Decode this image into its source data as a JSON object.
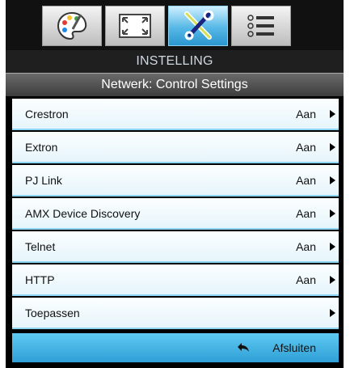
{
  "tabs": [
    {
      "icon": "palette-icon",
      "active": false
    },
    {
      "icon": "fullscreen-icon",
      "active": false
    },
    {
      "icon": "tools-icon",
      "active": true
    },
    {
      "icon": "list-icon",
      "active": false
    }
  ],
  "header": {
    "title": "INSTELLING",
    "subtitle": "Netwerk: Control Settings"
  },
  "items": [
    {
      "label": "Crestron",
      "value": "Aan"
    },
    {
      "label": "Extron",
      "value": "Aan"
    },
    {
      "label": "PJ Link",
      "value": "Aan"
    },
    {
      "label": "AMX Device Discovery",
      "value": "Aan"
    },
    {
      "label": "Telnet",
      "value": "Aan"
    },
    {
      "label": "HTTP",
      "value": "Aan"
    },
    {
      "label": "Toepassen",
      "value": ""
    }
  ],
  "footer": {
    "exit_label": "Afsluiten"
  }
}
